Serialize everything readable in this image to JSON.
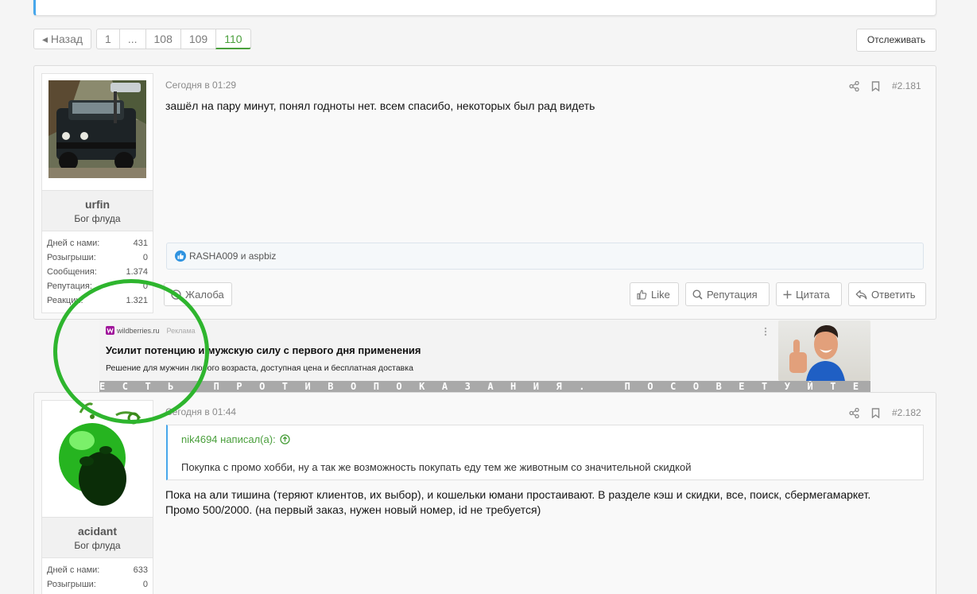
{
  "pager": {
    "back_label": "◂ Назад",
    "pages": [
      "1",
      "...",
      "108",
      "109",
      "110"
    ],
    "follow_label": "Отслеживать"
  },
  "posts": [
    {
      "username": "urfin",
      "user_title": "Бог флуда",
      "stats": [
        {
          "label": "Дней с нами:",
          "value": "431"
        },
        {
          "label": "Розыгрыши:",
          "value": "0"
        },
        {
          "label": "Сообщения:",
          "value": "1.374"
        },
        {
          "label": "Репутация:",
          "value": "0"
        },
        {
          "label": "Реакции:",
          "value": "1.321"
        }
      ],
      "time": "Сегодня в 01:29",
      "number": "#2.181",
      "text": "зашёл на пару минут, понял годноты нет. всем спасибо, некоторых был рад видеть",
      "reactions": "RASHA009 и aspbiz",
      "report_label": "Жалоба",
      "like_label": "Like",
      "reputation_label": "Репутация",
      "quote_label": "Цитата",
      "reply_label": "Ответить"
    },
    {
      "username": "acidant",
      "user_title": "Бог флуда",
      "stats": [
        {
          "label": "Дней с нами:",
          "value": "633"
        },
        {
          "label": "Розыгрыши:",
          "value": "0"
        }
      ],
      "time": "Сегодня в 01:44",
      "number": "#2.182",
      "quote_author": "nik4694 написал(а):",
      "quote_text": "Покупка с промо хобби, ну а так же возможность покупать еду тем же животным со значительной скидкой",
      "text_line1": "Пока на али тишина (теряют клиентов, их выбор), и кошельки юмани простаивают. В разделе кэш и скидки, все, поиск, сбермегамаркет.",
      "text_line2": "Промо 500/2000. (на первый заказ, нужен новый номер, id не требуется)"
    }
  ],
  "ad": {
    "source": "wildberries.ru",
    "tag": "Реклама",
    "title": "Усилит потенцию и мужскую силу с первого дня применения",
    "description": "Решение для мужчин любого возраста, доступная цена и бесплатная доставка",
    "warning": "ЕСТЬ ПРОТИВОПОКАЗАНИЯ. ПОСОВЕТУЙТЕСЬ С ВРАЧОМ"
  },
  "colors": {
    "accent_green": "#4a9f3c",
    "accent_blue": "#47a7eb",
    "annotation_circle": "#2eb52e"
  }
}
